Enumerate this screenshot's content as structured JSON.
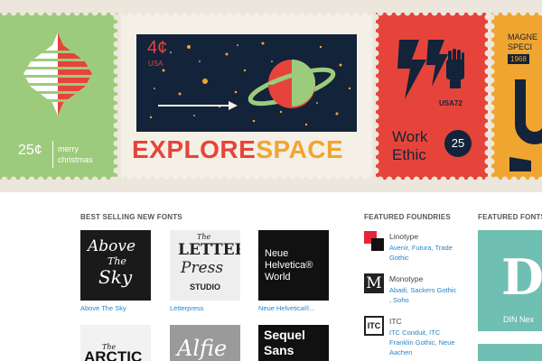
{
  "banner": {
    "stamp_holiday": {
      "value": "25¢",
      "greeting_line1": "merry",
      "greeting_line2": "christmas"
    },
    "stamp_space": {
      "value": "4¢",
      "country": "USA",
      "word1": "EXPLORE",
      "word2": "SPACE"
    },
    "stamp_work": {
      "country_year": "USA72",
      "line1": "Work",
      "line2": "Ethic",
      "badge": "25"
    },
    "stamp_magnet": {
      "line1": "MAGNE",
      "line2": "SPECI",
      "year": "1968"
    }
  },
  "best_selling": {
    "heading": "BEST SELLING NEW FONTS",
    "items": [
      {
        "art_line1": "Above",
        "art_line2": "The",
        "art_line3": "Sky",
        "caption": "Above The Sky"
      },
      {
        "art_line1": "The",
        "art_line2": "LETTER",
        "art_line3": "Press",
        "art_line4": "STUDIO",
        "caption": "Letterpress"
      },
      {
        "art_line1": "Neue",
        "art_line2": "Helvetica®",
        "art_line3": "World",
        "caption": "Neue Helvetica®..."
      },
      {
        "art_line1": "The",
        "art_line2": "ARCTIC"
      },
      {
        "art_line1": "Alfie"
      },
      {
        "art_line1": "Sequel",
        "art_line2": "Sans"
      }
    ]
  },
  "foundries": {
    "heading": "FEATURED FOUNDRIES",
    "items": [
      {
        "name": "Linotype",
        "links_line1": "Avenir, Futura, Trade",
        "links_line2": "Gothic"
      },
      {
        "name": "Monotype",
        "logo_letter": "M",
        "links_line1": "Abadi, Sackers Gothic",
        "links_line2": ", Soho"
      },
      {
        "name": "ITC",
        "logo_letter": "ITC",
        "links_line1": "ITC Conduit, ITC",
        "links_line2": "Franklin Gothic, Neue",
        "links_line3": "Aachen"
      }
    ]
  },
  "featured_fonts": {
    "heading": "FEATURED FONTS",
    "tile_letter": "D",
    "tile_caption": "DIN Nex"
  },
  "colors": {
    "banner_bg": "#ece6dc",
    "green": "#9dcb7c",
    "red": "#e6443a",
    "orange": "#f0a531",
    "navy": "#13233a",
    "teal": "#6fbfb2",
    "link": "#2a84c6"
  }
}
